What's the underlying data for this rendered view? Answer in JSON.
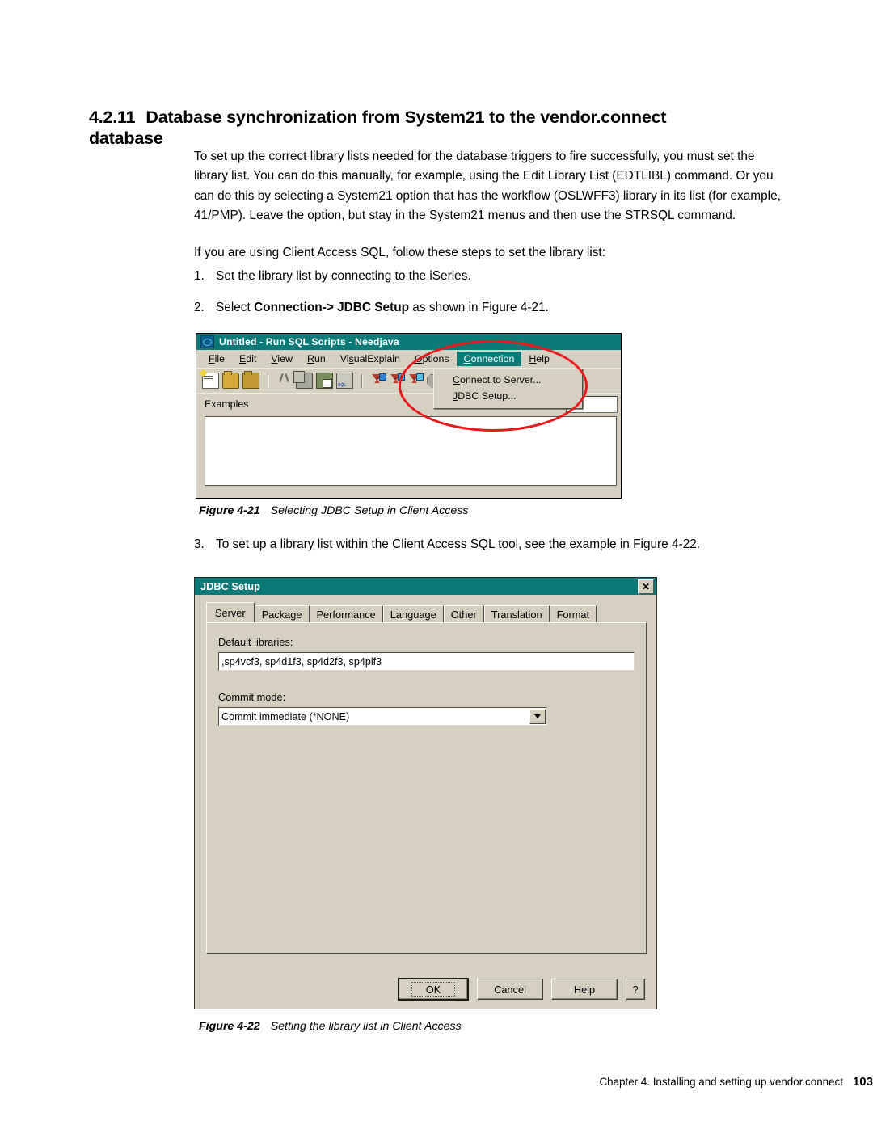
{
  "heading": {
    "number": "4.2.11",
    "text": "Database synchronization from System21 to the vendor.connect database"
  },
  "paragraphs": [
    "To set up the correct library lists needed for the database triggers to fire successfully, you must set the library list. You can do this manually, for example, using the Edit Library List (EDTLIBL) command. Or you can do this by selecting a System21 option that has the workflow (OSLWFF3) library in its list (for example, 41/PMP). Leave the option, but stay in the System21 menus and then use the STRSQL command.",
    "If you are using Client Access SQL, follow these steps to set the library list:"
  ],
  "steps": [
    {
      "marker": "1.",
      "text": "Set the library list by connecting to the iSeries.",
      "bold": "",
      "tail": ""
    },
    {
      "marker": "2.",
      "lead": "Select ",
      "bold": "Connection-> JDBC Setup",
      "tail": " as shown in Figure 4-21."
    },
    {
      "marker": "3.",
      "text": "To set up a library list within the Client Access SQL tool, see the example in Figure 4-22."
    }
  ],
  "captions": [
    {
      "number": "Figure 4-21",
      "text": "Selecting JDBC Setup in Client Access"
    },
    {
      "number": "Figure 4-22",
      "text": "Setting the library list in Client Access"
    }
  ],
  "footer": {
    "text": "Chapter 4. Installing and setting up vendor.connect",
    "page": "103"
  },
  "figure21": {
    "title": "Untitled - Run SQL Scripts - Needjava",
    "menus": [
      {
        "label": "File",
        "mnemonic": "F",
        "active": false
      },
      {
        "label": "Edit",
        "mnemonic": "E",
        "active": false
      },
      {
        "label": "View",
        "mnemonic": "V",
        "active": false
      },
      {
        "label": "Run",
        "mnemonic": "R",
        "active": false
      },
      {
        "label": "VisualExplain",
        "mnemonic": "s",
        "active": false
      },
      {
        "label": "Options",
        "mnemonic": "O",
        "active": false
      },
      {
        "label": "Connection",
        "mnemonic": "C",
        "active": true
      },
      {
        "label": "Help",
        "mnemonic": "H",
        "active": false
      }
    ],
    "toolbar_icons": [
      "new-script-icon",
      "open-icon",
      "open-alt-icon",
      "cut-icon",
      "copy-icon",
      "paste-icon",
      "sql-file-icon",
      "run-all-icon",
      "run-from-selected-icon",
      "run-selected-icon",
      "stop-icon",
      "stop-alt-icon"
    ],
    "dropdown": {
      "items": [
        {
          "label": "Connect to Server...",
          "mnemonic": "C"
        },
        {
          "label": "JDBC Setup...",
          "mnemonic": "J"
        }
      ]
    },
    "examples_label": "Examples",
    "examples_value": ""
  },
  "figure22": {
    "title": "JDBC Setup",
    "close_label": "✕",
    "tabs": [
      {
        "label": "Server",
        "selected": true
      },
      {
        "label": "Package",
        "selected": false
      },
      {
        "label": "Performance",
        "selected": false
      },
      {
        "label": "Language",
        "selected": false
      },
      {
        "label": "Other",
        "selected": false
      },
      {
        "label": "Translation",
        "selected": false
      },
      {
        "label": "Format",
        "selected": false
      }
    ],
    "fields": {
      "default_libraries_label": "Default libraries:",
      "default_libraries_value": ",sp4vcf3, sp4d1f3, sp4d2f3, sp4plf3",
      "commit_mode_label": "Commit mode:",
      "commit_mode_value": "Commit immediate  (*NONE)"
    },
    "buttons": {
      "ok": "OK",
      "cancel": "Cancel",
      "help": "Help",
      "whatsthis": "?"
    }
  },
  "colors": {
    "titlebar_teal": "#0a7a78",
    "dialog_face": "#d6d0c0",
    "annotation_red": "#e8191b"
  }
}
